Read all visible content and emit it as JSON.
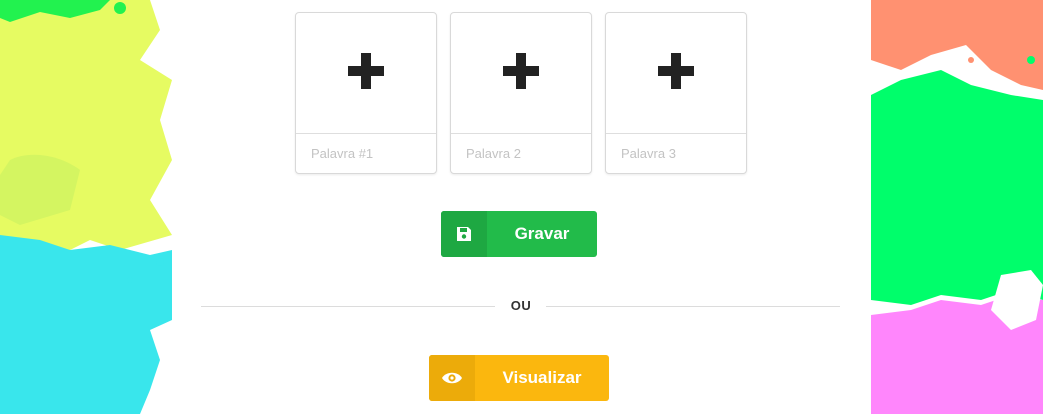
{
  "word_cards": [
    {
      "placeholder": "Palavra #1",
      "icon": "plus-icon"
    },
    {
      "placeholder": "Palavra 2",
      "icon": "plus-icon"
    },
    {
      "placeholder": "Palavra 3",
      "icon": "plus-icon"
    }
  ],
  "actions": {
    "save_label": "Gravar",
    "save_icon": "floppy-disk-icon",
    "divider_text": "OU",
    "view_label": "Visualizar",
    "view_icon": "eye-icon"
  },
  "colors": {
    "save_button": "#22bb4a",
    "view_button": "#fbb70e",
    "splash_green": "#00fe6b",
    "splash_yellow": "#e6fb62",
    "splash_cyan": "#39e6ec",
    "splash_salmon": "#ff9171",
    "splash_pink": "#ff86fc"
  }
}
